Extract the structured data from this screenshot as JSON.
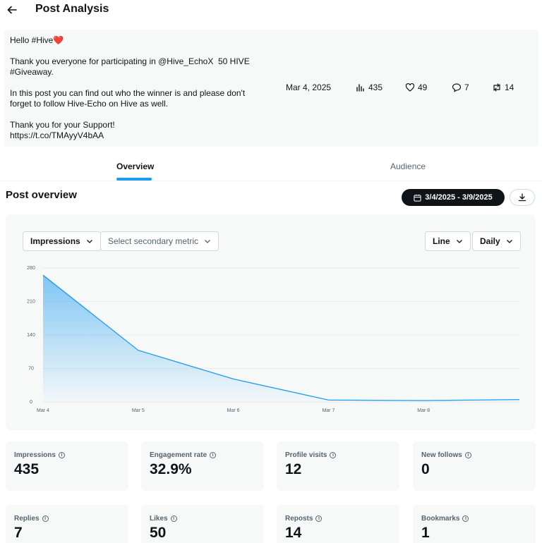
{
  "header": {
    "title": "Post Analysis"
  },
  "post": {
    "text": "Hello #Hive❤️\n\nThank you everyone for participating in @Hive_EchoX  50 HIVE #Giveaway.\n\nIn this post you can find out who the winner is and please don't forget to follow Hive-Echo on Hive as well.\n\nThank you for your Support!\nhttps://t.co/TMAyyV4bAA",
    "date": "Mar 4, 2025",
    "views": "435",
    "likes": "49",
    "replies": "7",
    "reposts": "14"
  },
  "tabs": [
    {
      "label": "Overview",
      "active": true
    },
    {
      "label": "Audience",
      "active": false
    }
  ],
  "overview": {
    "title": "Post overview",
    "date_range": "3/4/2025 - 3/9/2025",
    "primary_metric": "Impressions",
    "secondary_metric_placeholder": "Select secondary metric",
    "chart_type_label": "Line",
    "interval_label": "Daily"
  },
  "chart_data": {
    "type": "area",
    "x": [
      "Mar 4",
      "Mar 5",
      "Mar 6",
      "Mar 7",
      "Mar 8",
      "Mar 9"
    ],
    "x_tick_labels": [
      "Mar 4",
      "Mar 5",
      "Mar 6",
      "Mar 7",
      "Mar 8"
    ],
    "y_ticks": [
      0,
      70,
      140,
      210,
      280
    ],
    "ylim": [
      0,
      280
    ],
    "series": [
      {
        "values": [
          265,
          108,
          48,
          4,
          3,
          5
        ]
      }
    ],
    "grid": true,
    "colors": {
      "line": "#1d9bf0"
    }
  },
  "metrics": [
    {
      "label": "Impressions",
      "value": "435"
    },
    {
      "label": "Engagement rate",
      "value": "32.9%"
    },
    {
      "label": "Profile visits",
      "value": "12"
    },
    {
      "label": "New follows",
      "value": "0"
    },
    {
      "label": "Replies",
      "value": "7"
    },
    {
      "label": "Likes",
      "value": "50"
    },
    {
      "label": "Reposts",
      "value": "14"
    },
    {
      "label": "Bookmarks",
      "value": "1"
    }
  ]
}
